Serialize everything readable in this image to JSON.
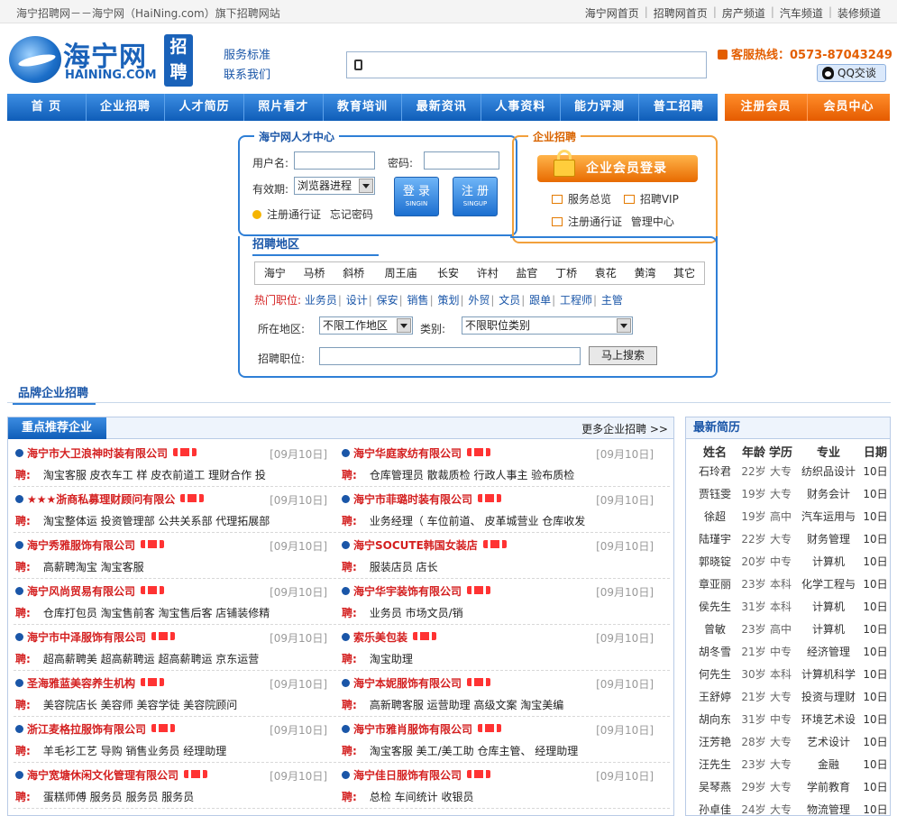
{
  "top": {
    "site_tag": "海宁招聘网－－海宁网（HaiNing.com）旗下招聘网站",
    "links": [
      "海宁网首页",
      "招聘网首页",
      "房产频道",
      "汽车频道",
      "装修频道"
    ]
  },
  "header": {
    "logo_cn": "海宁网",
    "logo_en": "HAINING.COM",
    "logo_badge": "招聘",
    "service_link": "服务标准",
    "contact_link": "联系我们",
    "hotline": "客服热线：0573-87043249",
    "qq_label": "QQ交谈"
  },
  "nav": {
    "main": [
      "首 页",
      "企业招聘",
      "人才简历",
      "照片看才",
      "教育培训",
      "最新资讯",
      "人事资料",
      "能力评测",
      "普工招聘"
    ],
    "member": [
      "注册会员",
      "会员中心"
    ]
  },
  "talent": {
    "title": "海宁网人才中心",
    "username_label": "用户名:",
    "password_label": "密码:",
    "validity_label": "有效期:",
    "validity_value": "浏览器进程",
    "login_btn": "登 录",
    "login_sub": "SINGIN",
    "signup_btn": "注 册",
    "signup_sub": "SINGUP",
    "register_link": "注册通行证",
    "forgot_link": "忘记密码"
  },
  "enterprise": {
    "title": "企业招聘",
    "login_btn": "企业会员登录",
    "service_link": "服务总览",
    "vip_link": "招聘VIP",
    "register_link": "注册通行证",
    "admin_link": "管理中心"
  },
  "area": {
    "title": "招聘地区",
    "places": [
      "海宁",
      "马桥",
      "斜桥",
      "周王庙",
      "长安",
      "许村",
      "盐官",
      "丁桥",
      "袁花",
      "黄湾",
      "其它"
    ],
    "hot_label": "热门职位:",
    "hot_jobs": [
      "业务员",
      "设计",
      "保安",
      "销售",
      "策划",
      "外贸",
      "文员",
      "跟单",
      "工程师",
      "主管"
    ],
    "region_label": "所在地区:",
    "region_value": "不限工作地区",
    "category_label": "类别:",
    "category_value": "不限职位类别",
    "keyword_label": "招聘职位:",
    "search_btn": "马上搜索"
  },
  "brand_title": "品牌企业招聘",
  "recommended": {
    "title": "重点推荐企业",
    "more": "更多企业招聘 >>",
    "job_prefix": "聘:",
    "left": [
      {
        "company": "海宁市大卫浪神时装有限公司",
        "date": "[09月10日]",
        "jobs": "淘宝客服 皮衣车工 样 皮衣前道工 理财合作 投"
      },
      {
        "company": "★★★浙商私募理财顾问有限公",
        "date": "[09月10日]",
        "jobs": "淘宝整体运 投资管理部 公共关系部 代理拓展部"
      },
      {
        "company": "海宁秀雅服饰有限公司",
        "date": "[09月10日]",
        "jobs": "高薪聘淘宝 淘宝客服"
      },
      {
        "company": "海宁风尚贸易有限公司",
        "date": "[09月10日]",
        "jobs": "仓库打包员 淘宝售前客 淘宝售后客 店铺装修精"
      },
      {
        "company": "海宁市中泽服饰有限公司",
        "date": "[09月10日]",
        "jobs": "超高薪聘美 超高薪聘运 超高薪聘运 京东运营"
      },
      {
        "company": "圣海雅蓝美容养生机构",
        "date": "[09月10日]",
        "jobs": "美容院店长 美容师 美容学徒 美容院顾问"
      },
      {
        "company": "浙江麦格拉服饰有限公司",
        "date": "[09月10日]",
        "jobs": "羊毛衫工艺 导购 销售业务员 经理助理"
      },
      {
        "company": "海宁宽塘休闲文化管理有限公司",
        "date": "[09月10日]",
        "jobs": "蛋糕师傅 服务员 服务员 服务员"
      }
    ],
    "right": [
      {
        "company": "海宁华庭家纺有限公司",
        "date": "[09月10日]",
        "jobs": "仓库管理员 散裁质检 行政人事主 验布质检"
      },
      {
        "company": "海宁市菲璐时装有限公司",
        "date": "[09月10日]",
        "jobs": "业务经理（ 车位前道、 皮革城营业 仓库收发"
      },
      {
        "company": "海宁SOCUTE韩国女装店",
        "date": "[09月10日]",
        "jobs": "服装店员 店长"
      },
      {
        "company": "海宁华宇装饰有限公司",
        "date": "[09月10日]",
        "jobs": "业务员 市场文员/销"
      },
      {
        "company": "索乐美包装",
        "date": "[09月10日]",
        "jobs": "淘宝助理"
      },
      {
        "company": "海宁本妮服饰有限公司",
        "date": "[09月10日]",
        "jobs": "高新聘客服 运营助理 高级文案 淘宝美编"
      },
      {
        "company": "海宁市雅肖服饰有限公司",
        "date": "[09月10日]",
        "jobs": "淘宝客服 美工/美工助 仓库主管、 经理助理"
      },
      {
        "company": "海宁佳日服饰有限公司",
        "date": "[09月10日]",
        "jobs": "总检 车间统计 收银员"
      }
    ]
  },
  "resumes": {
    "title": "最新简历",
    "columns": [
      "姓名",
      "年龄",
      "学历",
      "专业",
      "日期"
    ],
    "rows": [
      [
        "石玲君",
        "22岁",
        "大专",
        "纺织品设计",
        "10日"
      ],
      [
        "贾钰雯",
        "19岁",
        "大专",
        "财务会计",
        "10日"
      ],
      [
        "徐超",
        "19岁",
        "高中",
        "汽车运用与",
        "10日"
      ],
      [
        "陆瑾宇",
        "22岁",
        "大专",
        "财务管理",
        "10日"
      ],
      [
        "郭晓锭",
        "20岁",
        "中专",
        "计算机",
        "10日"
      ],
      [
        "章亚丽",
        "23岁",
        "本科",
        "化学工程与",
        "10日"
      ],
      [
        "侯先生",
        "31岁",
        "本科",
        "计算机",
        "10日"
      ],
      [
        "曾敏",
        "23岁",
        "高中",
        "计算机",
        "10日"
      ],
      [
        "胡冬雪",
        "21岁",
        "中专",
        "经济管理",
        "10日"
      ],
      [
        "何先生",
        "30岁",
        "本科",
        "计算机科学",
        "10日"
      ],
      [
        "王舒婷",
        "21岁",
        "大专",
        "投资与理财",
        "10日"
      ],
      [
        "胡向东",
        "31岁",
        "中专",
        "环境艺术设",
        "10日"
      ],
      [
        "汪芳艳",
        "28岁",
        "大专",
        "艺术设计",
        "10日"
      ],
      [
        "汪先生",
        "23岁",
        "大专",
        "金融",
        "10日"
      ],
      [
        "吴琴燕",
        "29岁",
        "大专",
        "学前教育",
        "10日"
      ],
      [
        "孙卓佳",
        "24岁",
        "大专",
        "物流管理",
        "10日"
      ]
    ]
  }
}
